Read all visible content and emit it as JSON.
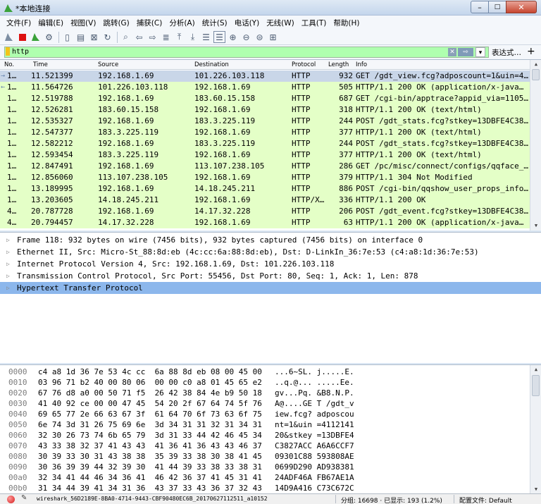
{
  "window": {
    "title": "*本地连接",
    "buttons": {
      "minimize": "–",
      "maximize": "□",
      "close": "✕"
    }
  },
  "menu": [
    "文件(F)",
    "编辑(E)",
    "视图(V)",
    "跳转(G)",
    "捕获(C)",
    "分析(A)",
    "统计(S)",
    "电话(Y)",
    "无线(W)",
    "工具(T)",
    "帮助(H)"
  ],
  "toolbar": {
    "icons": [
      "shark-fin-start-icon",
      "stop-icon",
      "restart-icon",
      "options-gear-icon",
      "open-file-icon",
      "save-file-icon",
      "close-file-icon",
      "reload-icon",
      "find-icon",
      "back-arrow-icon",
      "forward-arrow-icon",
      "go-to-packet-icon",
      "first-packet-icon",
      "last-packet-icon",
      "autoscroll-icon",
      "colorize-icon",
      "zoom-in-icon",
      "zoom-out-icon",
      "zoom-normal-icon",
      "resize-columns-icon"
    ]
  },
  "filter": {
    "value": "http",
    "expression_label": "表达式…",
    "plus_label": "+",
    "color": "#afffaf"
  },
  "packet_list": {
    "columns": [
      "No.",
      "Time",
      "Source",
      "Destination",
      "Protocol",
      "Length",
      "Info"
    ],
    "row_color": "#e4ffc7",
    "rows": [
      {
        "no": "1…",
        "time": "11.521399",
        "src": "192.168.1.69",
        "dst": "101.226.103.118",
        "proto": "HTTP",
        "len": "932",
        "info": "GET /gdt_view.fcg?adposcount=1&uin=4…",
        "marker": "→",
        "selected": true
      },
      {
        "no": "1…",
        "time": "11.564726",
        "src": "101.226.103.118",
        "dst": "192.168.1.69",
        "proto": "HTTP",
        "len": "505",
        "info": "HTTP/1.1 200 OK  (application/x-java…",
        "marker": "←"
      },
      {
        "no": "1…",
        "time": "12.519788",
        "src": "192.168.1.69",
        "dst": "183.60.15.158",
        "proto": "HTTP",
        "len": "687",
        "info": "GET /cgi-bin/apptrace?appid_via=1105…"
      },
      {
        "no": "1…",
        "time": "12.526281",
        "src": "183.60.15.158",
        "dst": "192.168.1.69",
        "proto": "HTTP",
        "len": "318",
        "info": "HTTP/1.1 200 OK  (text/html)"
      },
      {
        "no": "1…",
        "time": "12.535327",
        "src": "192.168.1.69",
        "dst": "183.3.225.119",
        "proto": "HTTP",
        "len": "244",
        "info": "POST /gdt_stats.fcg?stkey=13DBFE4C38…"
      },
      {
        "no": "1…",
        "time": "12.547377",
        "src": "183.3.225.119",
        "dst": "192.168.1.69",
        "proto": "HTTP",
        "len": "377",
        "info": "HTTP/1.1 200 OK  (text/html)"
      },
      {
        "no": "1…",
        "time": "12.582212",
        "src": "192.168.1.69",
        "dst": "183.3.225.119",
        "proto": "HTTP",
        "len": "244",
        "info": "POST /gdt_stats.fcg?stkey=13DBFE4C38…"
      },
      {
        "no": "1…",
        "time": "12.593454",
        "src": "183.3.225.119",
        "dst": "192.168.1.69",
        "proto": "HTTP",
        "len": "377",
        "info": "HTTP/1.1 200 OK  (text/html)"
      },
      {
        "no": "1…",
        "time": "12.847491",
        "src": "192.168.1.69",
        "dst": "113.107.238.105",
        "proto": "HTTP",
        "len": "286",
        "info": "GET /pc/misc/connect/configs/qqface_…"
      },
      {
        "no": "1…",
        "time": "12.856060",
        "src": "113.107.238.105",
        "dst": "192.168.1.69",
        "proto": "HTTP",
        "len": "379",
        "info": "HTTP/1.1 304 Not Modified"
      },
      {
        "no": "1…",
        "time": "13.189995",
        "src": "192.168.1.69",
        "dst": "14.18.245.211",
        "proto": "HTTP",
        "len": "886",
        "info": "POST /cgi-bin/qqshow_user_props_info…"
      },
      {
        "no": "1…",
        "time": "13.203605",
        "src": "14.18.245.211",
        "dst": "192.168.1.69",
        "proto": "HTTP/X…",
        "len": "336",
        "info": "HTTP/1.1 200 OK"
      },
      {
        "no": "4…",
        "time": "20.787728",
        "src": "192.168.1.69",
        "dst": "14.17.32.228",
        "proto": "HTTP",
        "len": "206",
        "info": "POST /gdt_event.fcg?stkey=13DBFE4C38…"
      },
      {
        "no": "4…",
        "time": "20.794457",
        "src": "14.17.32.228",
        "dst": "192.168.1.69",
        "proto": "HTTP",
        "len": "63",
        "info": "HTTP/1.1 200 OK  (application/x-java…"
      }
    ]
  },
  "details": [
    {
      "text": "Frame 118: 932 bytes on wire (7456 bits), 932 bytes captured (7456 bits) on interface 0"
    },
    {
      "text": "Ethernet II, Src: Micro-St_88:8d:eb (4c:cc:6a:88:8d:eb), Dst: D-LinkIn_36:7e:53 (c4:a8:1d:36:7e:53)"
    },
    {
      "text": "Internet Protocol Version 4, Src: 192.168.1.69, Dst: 101.226.103.118"
    },
    {
      "text": "Transmission Control Protocol, Src Port: 55456, Dst Port: 80, Seq: 1, Ack: 1, Len: 878"
    },
    {
      "text": "Hypertext Transfer Protocol",
      "selected": true
    }
  ],
  "bytes": [
    {
      "offset": "0000",
      "hex": "c4 a8 1d 36 7e 53 4c cc  6a 88 8d eb 08 00 45 00",
      "ascii": "...6~SL. j.....E."
    },
    {
      "offset": "0010",
      "hex": "03 96 71 b2 40 00 80 06  00 00 c0 a8 01 45 65 e2",
      "ascii": "..q.@... .....Ee."
    },
    {
      "offset": "0020",
      "hex": "67 76 d8 a0 00 50 71 f5  26 42 38 84 4e b9 50 18",
      "ascii": "gv...Pq. &B8.N.P."
    },
    {
      "offset": "0030",
      "hex": "41 40 92 ce 00 00 47 45  54 20 2f 67 64 74 5f 76",
      "ascii": "A@....GE T /gdt_v"
    },
    {
      "offset": "0040",
      "hex": "69 65 77 2e 66 63 67 3f  61 64 70 6f 73 63 6f 75",
      "ascii": "iew.fcg? adposcou"
    },
    {
      "offset": "0050",
      "hex": "6e 74 3d 31 26 75 69 6e  3d 34 31 31 32 31 34 31",
      "ascii": "nt=1&uin =4112141"
    },
    {
      "offset": "0060",
      "hex": "32 30 26 73 74 6b 65 79  3d 31 33 44 42 46 45 34",
      "ascii": "20&stkey =13DBFE4"
    },
    {
      "offset": "0070",
      "hex": "43 33 38 32 37 41 43 43  41 36 41 36 43 43 46 37",
      "ascii": "C3827ACC A6A6CCF7"
    },
    {
      "offset": "0080",
      "hex": "30 39 33 30 31 43 38 38  35 39 33 38 30 38 41 45",
      "ascii": "09301C88 593808AE"
    },
    {
      "offset": "0090",
      "hex": "30 36 39 39 44 32 39 30  41 44 39 33 38 33 38 31",
      "ascii": "0699D290 AD938381"
    },
    {
      "offset": "00a0",
      "hex": "32 34 41 44 46 34 36 41  46 42 36 37 41 45 31 41",
      "ascii": "24ADF46A FB67AE1A"
    },
    {
      "offset": "00b0",
      "hex": "31 34 44 39 41 34 31 36  43 37 33 43 36 37 32 43",
      "ascii": "14D9A416 C73C672C"
    }
  ],
  "status": {
    "file": "wireshark_56D2189E-8BA0-4714-9443-CBF90480EC6B_20170627112511_a10152",
    "packets": "分组: 16698 · 已显示: 193 (1.2%)",
    "profile": "配置文件: Default"
  }
}
